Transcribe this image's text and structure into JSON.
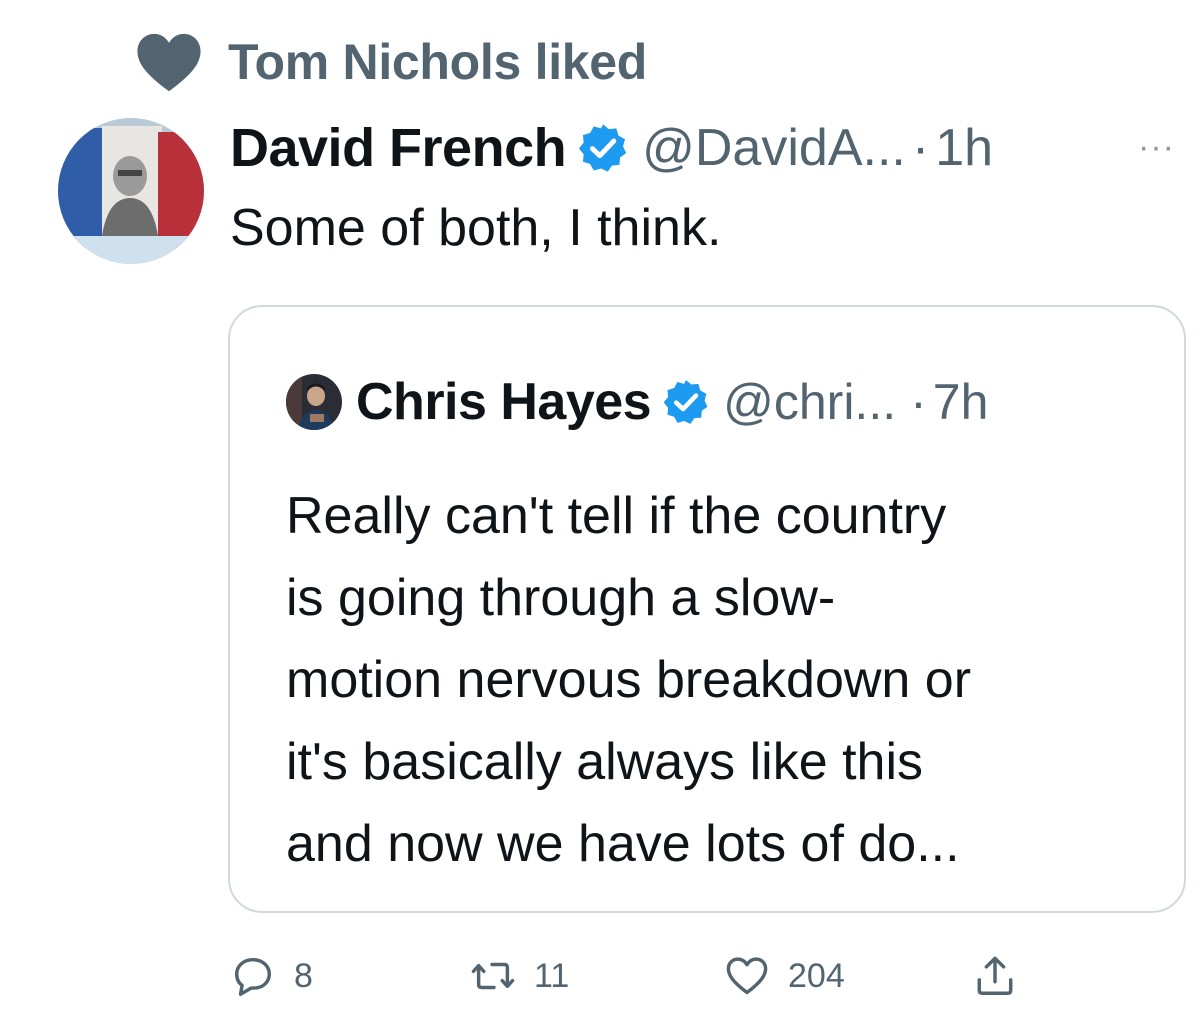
{
  "social_context": {
    "text": "Tom Nichols liked",
    "icon": "heart-icon"
  },
  "tweet": {
    "author": {
      "display_name": "David French",
      "handle": "@DavidA...",
      "verified": true,
      "avatar": "david-french-avatar"
    },
    "separator": "·",
    "time": "1h",
    "more_label": "···",
    "text": "Some of both, I think."
  },
  "quote": {
    "author": {
      "display_name": "Chris Hayes",
      "handle": "@chri...",
      "verified": true,
      "avatar": "chris-hayes-avatar"
    },
    "separator": "·",
    "time": "7h",
    "lines": [
      "Really can't tell if the country",
      "is going through a slow-",
      "motion nervous breakdown or",
      "it's basically always like this",
      "and now we have lots of do..."
    ]
  },
  "actions": {
    "replies": "8",
    "retweets": "11",
    "likes": "204",
    "icons": [
      "reply-icon",
      "retweet-icon",
      "like-icon",
      "share-icon"
    ]
  },
  "colors": {
    "verified_blue": "#1d9bf0",
    "secondary_text": "#536471",
    "border": "#cfd9de",
    "heart_grey": "#536471"
  }
}
